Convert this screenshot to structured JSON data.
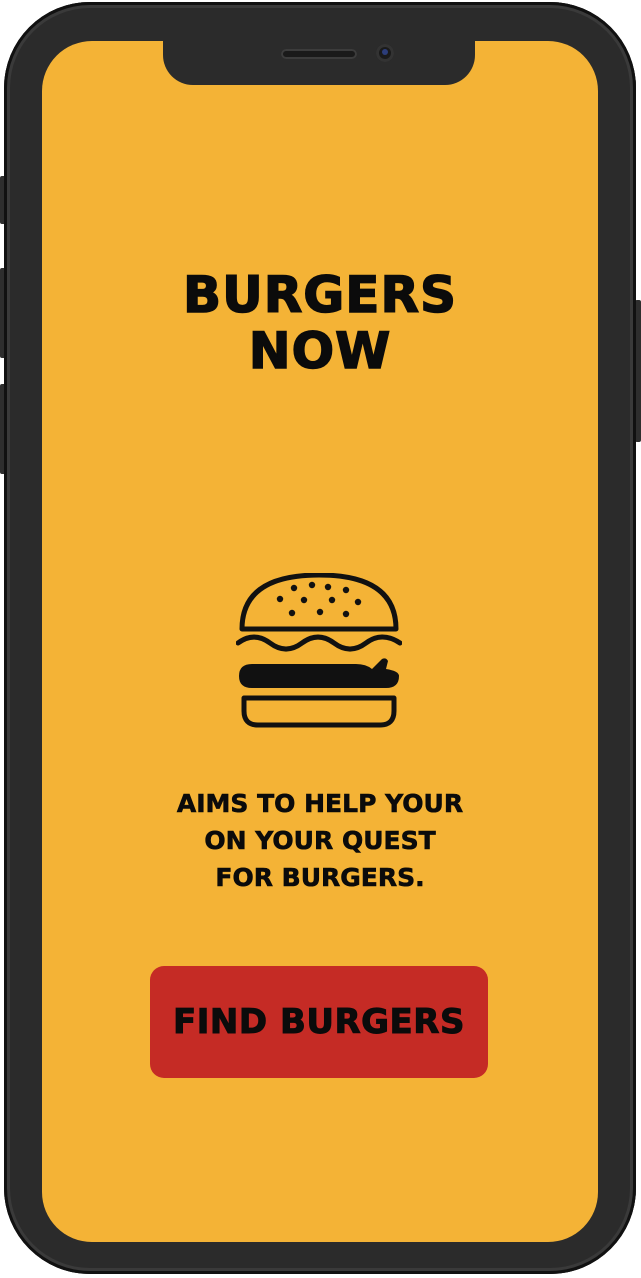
{
  "app": {
    "title_lines": [
      "BURGERS",
      "NOW"
    ],
    "tagline_lines": [
      "AIMS TO HELP YOUR",
      "ON YOUR QUEST",
      "FOR BURGERS."
    ],
    "cta_label": "FIND BURGERS",
    "icon": "burger-icon"
  },
  "colors": {
    "background": "#f4b336",
    "button": "#c52b25",
    "text": "#0b0b0b",
    "device_frame": "#2b2b2b"
  }
}
